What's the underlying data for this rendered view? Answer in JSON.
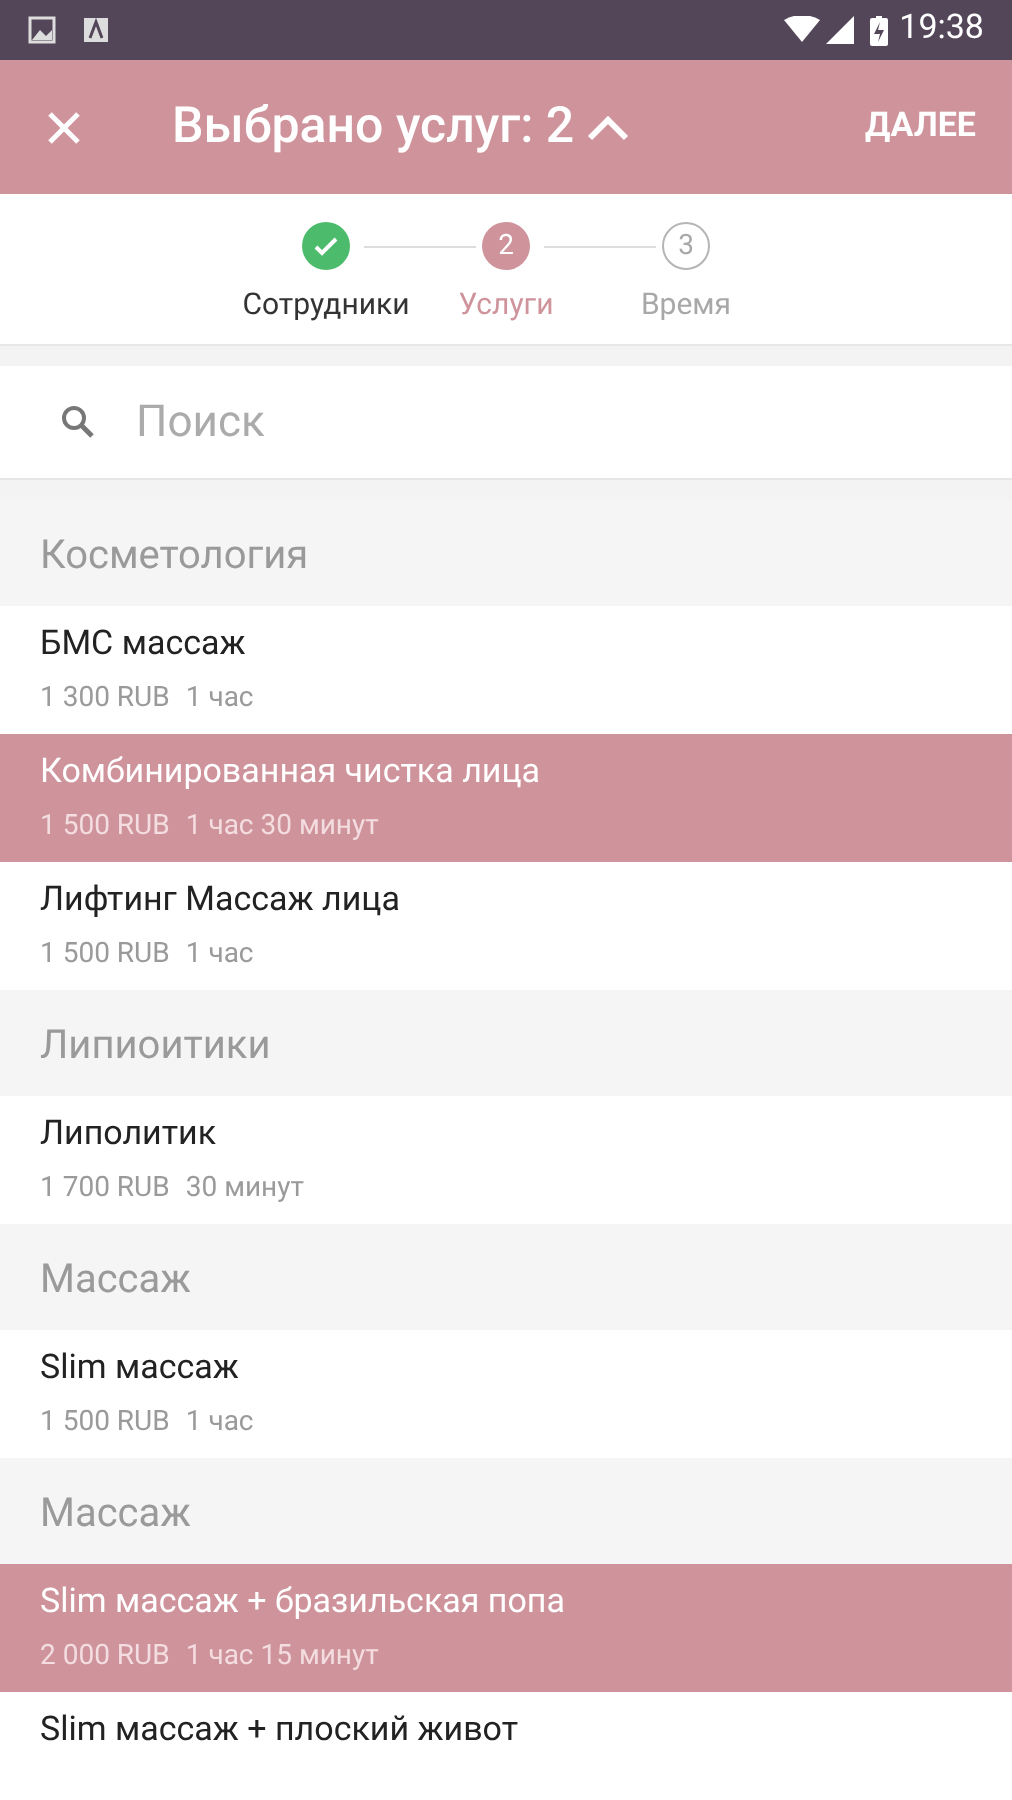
{
  "status_bar": {
    "time": "19:38"
  },
  "header": {
    "title": "Выбрано услуг: 2",
    "action": "ДАЛЕЕ"
  },
  "steps": [
    {
      "label": "Сотрудники",
      "done": true,
      "selected": false
    },
    {
      "number": "2",
      "label": "Услуги",
      "done": false,
      "selected": true
    },
    {
      "number": "3",
      "label": "Время",
      "done": false,
      "selected": false
    }
  ],
  "search": {
    "placeholder": "Поиск"
  },
  "sections": [
    {
      "title": "Косметология",
      "items": [
        {
          "name": "БМС массаж",
          "price": "1 300 RUB",
          "duration": "1 час",
          "selected": false
        },
        {
          "name": "Комбинированная чистка лица",
          "price": "1 500 RUB",
          "duration": "1 час 30 минут",
          "selected": true
        },
        {
          "name": "Лифтинг Массаж лица",
          "price": "1 500 RUB",
          "duration": "1 час",
          "selected": false
        }
      ]
    },
    {
      "title": "Липиоитики",
      "items": [
        {
          "name": "Липолитик",
          "price": "1 700 RUB",
          "duration": "30 минут",
          "selected": false
        }
      ]
    },
    {
      "title": "Массаж",
      "items": [
        {
          "name": "Slim массаж",
          "price": "1 500 RUB",
          "duration": "1 час",
          "selected": false
        }
      ]
    },
    {
      "title": "Массаж",
      "items": [
        {
          "name": "Slim массаж + бразильская попа",
          "price": "2 000 RUB",
          "duration": "1 час 15 минут",
          "selected": true
        },
        {
          "name": "Slim массаж + плоский живот",
          "selected": false
        }
      ]
    }
  ]
}
